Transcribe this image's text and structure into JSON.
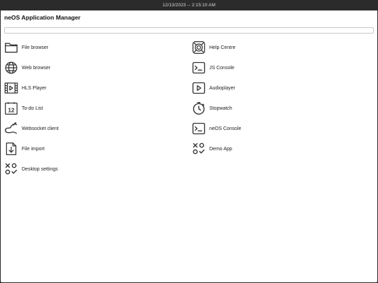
{
  "statusbar": {
    "datetime": "12/13/2023 -- 2:15:10 AM"
  },
  "window": {
    "title": "neOS Application Manager"
  },
  "search": {
    "value": "",
    "placeholder": ""
  },
  "apps_left": [
    {
      "label": "File browser",
      "icon": "folder-icon"
    },
    {
      "label": "Web browser",
      "icon": "globe-icon"
    },
    {
      "label": "HLS Player",
      "icon": "film-play-icon"
    },
    {
      "label": "To-do List",
      "icon": "calendar-icon"
    },
    {
      "label": "Websocket client",
      "icon": "cable-icon"
    },
    {
      "label": "File import",
      "icon": "file-import-icon"
    },
    {
      "label": "Desktop settings",
      "icon": "tic-tac-toe-icon"
    }
  ],
  "apps_right": [
    {
      "label": "Help Centre",
      "icon": "help-ring-icon"
    },
    {
      "label": "JS Console",
      "icon": "terminal-icon"
    },
    {
      "label": "Audioplayer",
      "icon": "play-icon"
    },
    {
      "label": "Stopwatch",
      "icon": "stopwatch-icon"
    },
    {
      "label": "neOS Console",
      "icon": "terminal-icon"
    },
    {
      "label": "Demo App",
      "icon": "tic-tac-toe-icon"
    }
  ]
}
